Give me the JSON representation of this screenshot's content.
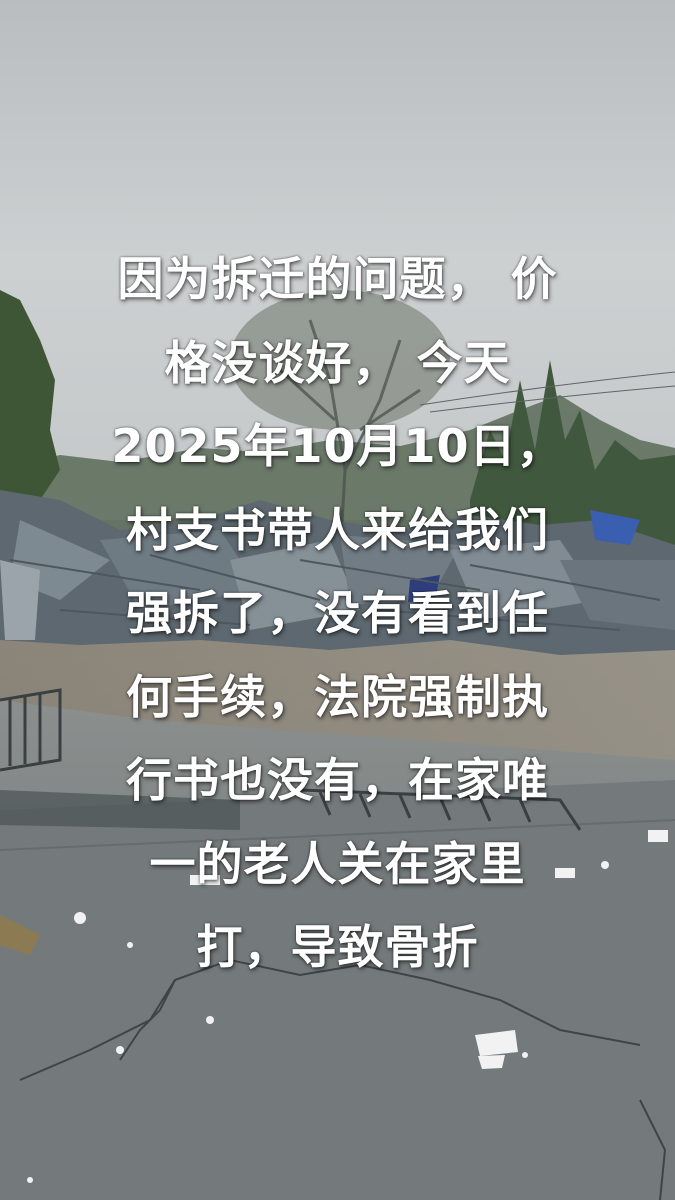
{
  "caption": {
    "lines": [
      "因为拆迁的问题， 价",
      "格没谈好， 今天",
      "2025年10月10日，",
      "村支书带人来给我们",
      "强拆了，没有看到任",
      "何手续，法院强制执",
      "行书也没有，在家唯",
      "一的老人关在家里",
      "打，导致骨折"
    ]
  },
  "scene": {
    "sky_color": "#c9cccd",
    "ground_color": "#7b8182",
    "foliage_color": "#3f5a3a",
    "debris_color": "#5f6a72",
    "accent_tarp_color": "#3b5fb0"
  }
}
